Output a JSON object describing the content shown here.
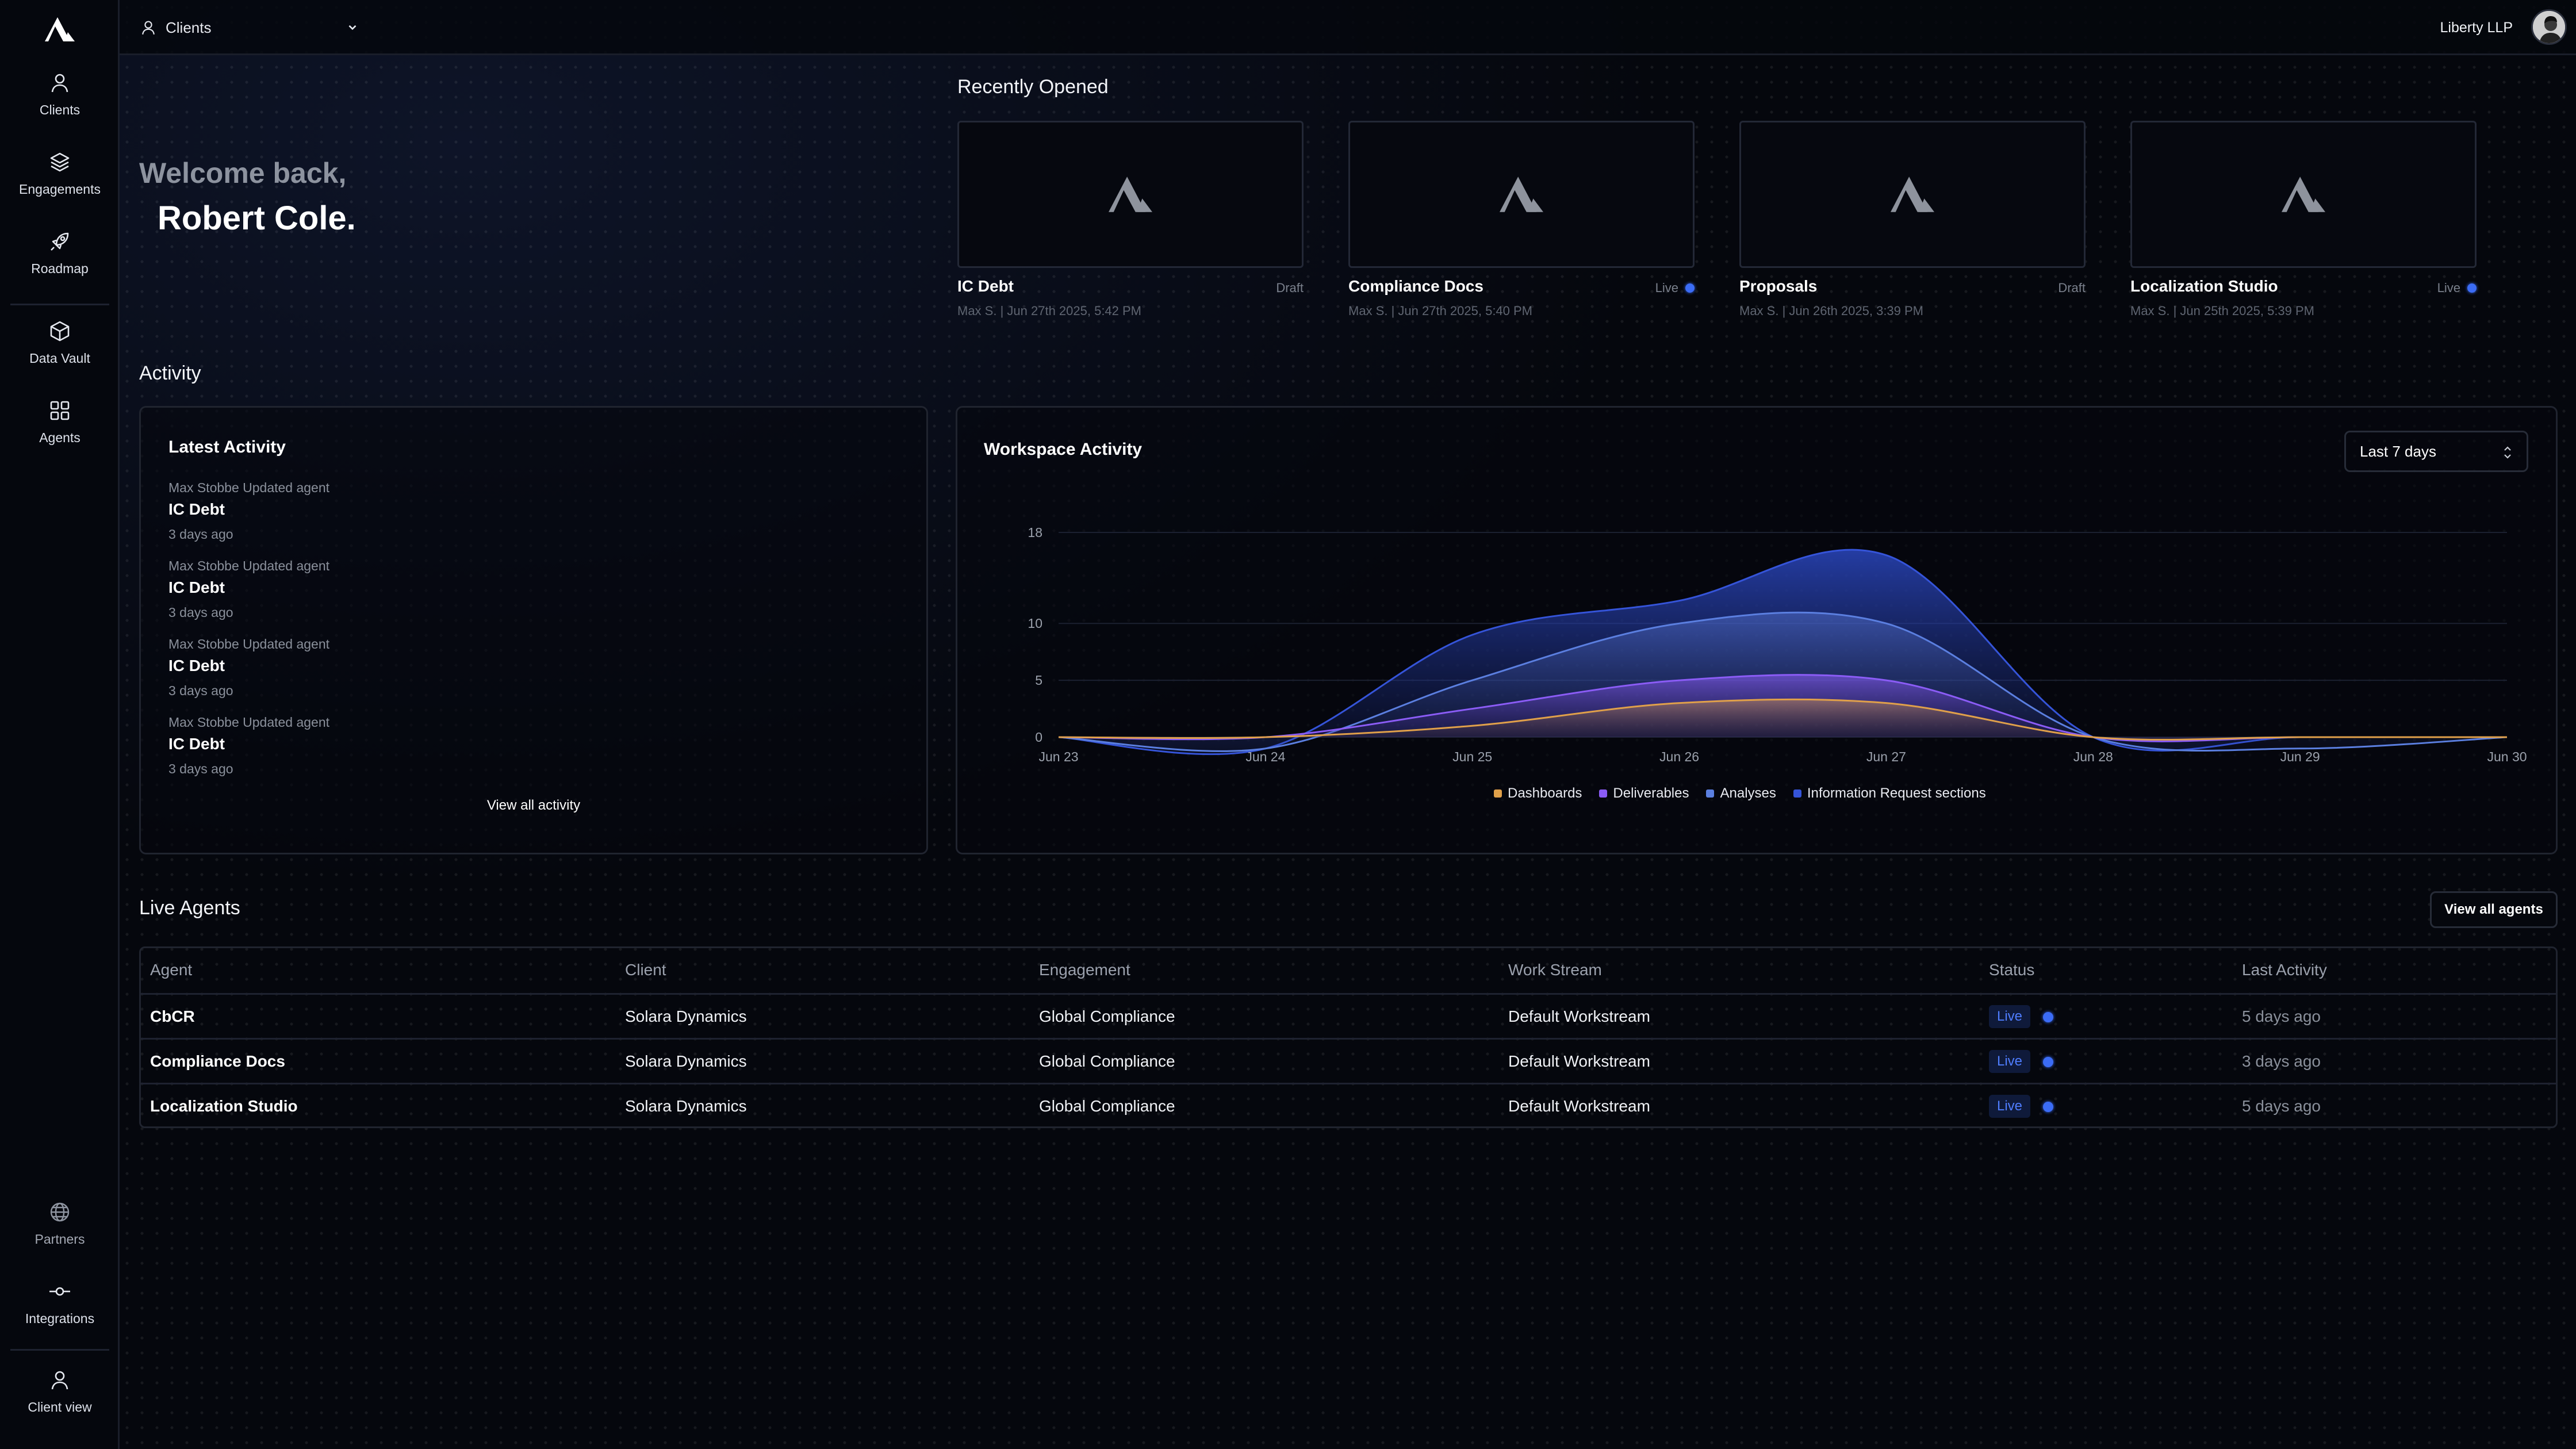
{
  "nav": {
    "clients": "Clients",
    "engagements": "Engagements",
    "roadmap": "Roadmap",
    "data_vault": "Data Vault",
    "agents": "Agents",
    "partners": "Partners",
    "integrations": "Integrations",
    "client_view": "Client view"
  },
  "topbar": {
    "selector_label": "Clients",
    "org_name": "Liberty LLP"
  },
  "welcome": {
    "line1": "Welcome back,",
    "line2": "Robert Cole."
  },
  "recent": {
    "title": "Recently Opened",
    "items": [
      {
        "name": "IC Debt",
        "status": "Draft",
        "meta": "Max S. | Jun 27th 2025, 5:42 PM"
      },
      {
        "name": "Compliance Docs",
        "status": "Live",
        "meta": "Max S. | Jun 27th 2025, 5:40 PM"
      },
      {
        "name": "Proposals",
        "status": "Draft",
        "meta": "Max S. | Jun 26th 2025, 3:39 PM"
      },
      {
        "name": "Localization Studio",
        "status": "Live",
        "meta": "Max S. | Jun 25th 2025, 5:39 PM"
      }
    ]
  },
  "activity": {
    "section_title": "Activity",
    "latest_title": "Latest Activity",
    "items": [
      {
        "who": "Max Stobbe Updated agent",
        "what": "IC Debt",
        "when": "3 days ago"
      },
      {
        "who": "Max Stobbe Updated agent",
        "what": "IC Debt",
        "when": "3 days ago"
      },
      {
        "who": "Max Stobbe Updated agent",
        "what": "IC Debt",
        "when": "3 days ago"
      },
      {
        "who": "Max Stobbe Updated agent",
        "what": "IC Debt",
        "when": "3 days ago"
      }
    ],
    "view_all": "View all activity"
  },
  "workspace": {
    "title": "Workspace Activity",
    "range": "Last 7 days"
  },
  "chart_data": {
    "type": "area",
    "title": "Workspace Activity",
    "categories": [
      "Jun 23",
      "Jun 24",
      "Jun 25",
      "Jun 26",
      "Jun 27",
      "Jun 28",
      "Jun 29",
      "Jun 30"
    ],
    "y_ticks": [
      0,
      5,
      10,
      18
    ],
    "ylim": [
      0,
      18
    ],
    "legend_position": "bottom",
    "series": [
      {
        "name": "Dashboards",
        "color": "#e0a04a",
        "values": [
          0,
          0,
          1,
          3,
          3,
          0,
          0,
          0
        ]
      },
      {
        "name": "Deliverables",
        "color": "#8b5cf6",
        "values": [
          0,
          0,
          2.5,
          5,
          5,
          0,
          0,
          0
        ]
      },
      {
        "name": "Analyses",
        "color": "#5b7fe0",
        "values": [
          0,
          -1,
          5,
          10,
          10,
          0,
          -1,
          0
        ]
      },
      {
        "name": "Information Request sections",
        "color": "#3554d9",
        "values": [
          0,
          -1,
          9,
          12,
          16,
          0,
          0,
          0
        ]
      }
    ]
  },
  "agents": {
    "section_title": "Live Agents",
    "view_all": "View all agents",
    "columns": [
      "Agent",
      "Client",
      "Engagement",
      "Work Stream",
      "Status",
      "Last Activity"
    ],
    "rows": [
      {
        "agent": "CbCR",
        "client": "Solara Dynamics",
        "engagement": "Global Compliance",
        "stream": "Default Workstream",
        "status": "Live",
        "last": "5 days ago"
      },
      {
        "agent": "Compliance Docs",
        "client": "Solara Dynamics",
        "engagement": "Global Compliance",
        "stream": "Default Workstream",
        "status": "Live",
        "last": "3 days ago"
      },
      {
        "agent": "Localization Studio",
        "client": "Solara Dynamics",
        "engagement": "Global Compliance",
        "stream": "Default Workstream",
        "status": "Live",
        "last": "5 days ago"
      }
    ]
  }
}
